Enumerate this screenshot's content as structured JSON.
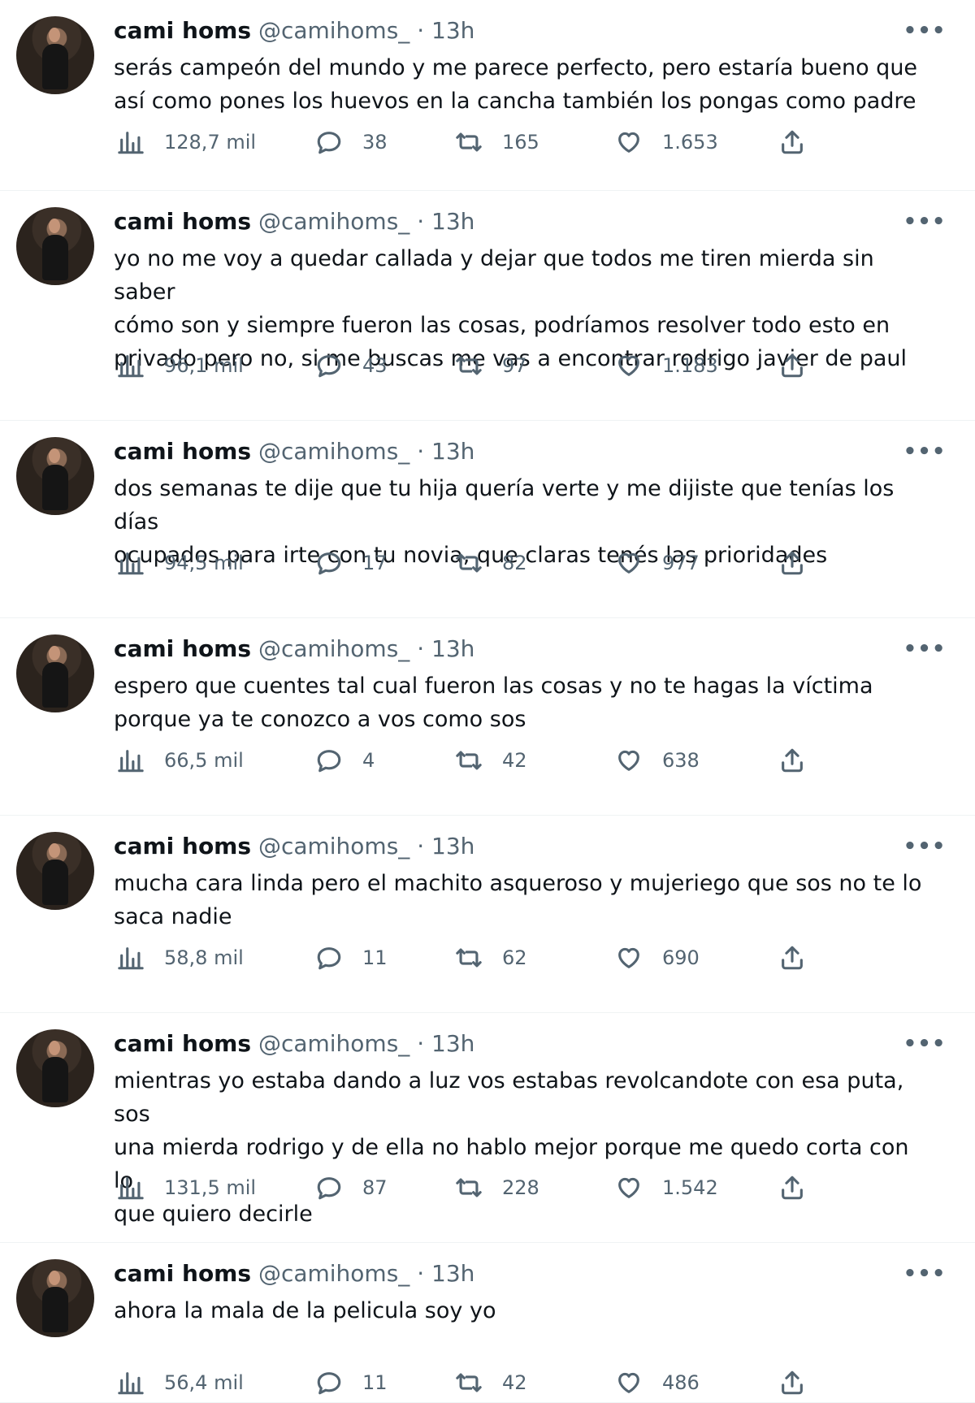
{
  "tweets": [
    {
      "name": "cami homs",
      "handle": "@camihoms_",
      "separator": "·",
      "time": "13h",
      "text": "serás campeón del mundo y me parece perfecto, pero estaría bueno que\nasí como pones los huevos en la cancha también los pongas como padre",
      "views": "128,7 mil",
      "replies": "38",
      "retweets": "165",
      "likes": "1.653"
    },
    {
      "name": "cami homs",
      "handle": "@camihoms_",
      "separator": "·",
      "time": "13h",
      "text": "yo no me voy a quedar callada y dejar que todos me tiren mierda sin saber\ncómo son y siempre fueron las cosas, podríamos resolver todo esto en\nprivado pero no, si me buscas me vas a encontrar rodrigo javier de paul",
      "views": "96,1 mil",
      "replies": "43",
      "retweets": "97",
      "likes": "1.183"
    },
    {
      "name": "cami homs",
      "handle": "@camihoms_",
      "separator": "·",
      "time": "13h",
      "text": "dos semanas te dije que tu hija quería verte y me dijiste que tenías los días\nocupados para irte con tu novia, que claras tenés las prioridades",
      "views": "94,5 mil",
      "replies": "17",
      "retweets": "82",
      "likes": "977"
    },
    {
      "name": "cami homs",
      "handle": "@camihoms_",
      "separator": "·",
      "time": "13h",
      "text": "espero que cuentes tal cual fueron las cosas y no te hagas la víctima\nporque ya te conozco a vos como sos",
      "views": "66,5 mil",
      "replies": "4",
      "retweets": "42",
      "likes": "638"
    },
    {
      "name": "cami homs",
      "handle": "@camihoms_",
      "separator": "·",
      "time": "13h",
      "text": "mucha cara linda pero el machito asqueroso y mujeriego que sos no te lo\nsaca nadie",
      "views": "58,8 mil",
      "replies": "11",
      "retweets": "62",
      "likes": "690"
    },
    {
      "name": "cami homs",
      "handle": "@camihoms_",
      "separator": "·",
      "time": "13h",
      "text": "mientras yo estaba dando a luz vos estabas revolcandote con esa puta, sos\nuna mierda rodrigo y de ella no hablo mejor porque me quedo corta con lo\nque quiero decirle",
      "views": "131,5 mil",
      "replies": "87",
      "retweets": "228",
      "likes": "1.542"
    },
    {
      "name": "cami homs",
      "handle": "@camihoms_",
      "separator": "·",
      "time": "13h",
      "text": "ahora la mala de la pelicula soy yo",
      "views": "56,4 mil",
      "replies": "11",
      "retweets": "42",
      "likes": "486"
    }
  ],
  "icons": {
    "avatar": "profile-photo",
    "more": "more-dots-icon",
    "views": "views-bar-chart-icon",
    "reply": "reply-bubble-icon",
    "retweet": "retweet-arrows-icon",
    "like": "heart-icon",
    "share": "share-upload-icon"
  },
  "colors": {
    "text": "#0f1419",
    "secondary": "#536471",
    "divider": "#eff3f4",
    "background": "#ffffff"
  }
}
